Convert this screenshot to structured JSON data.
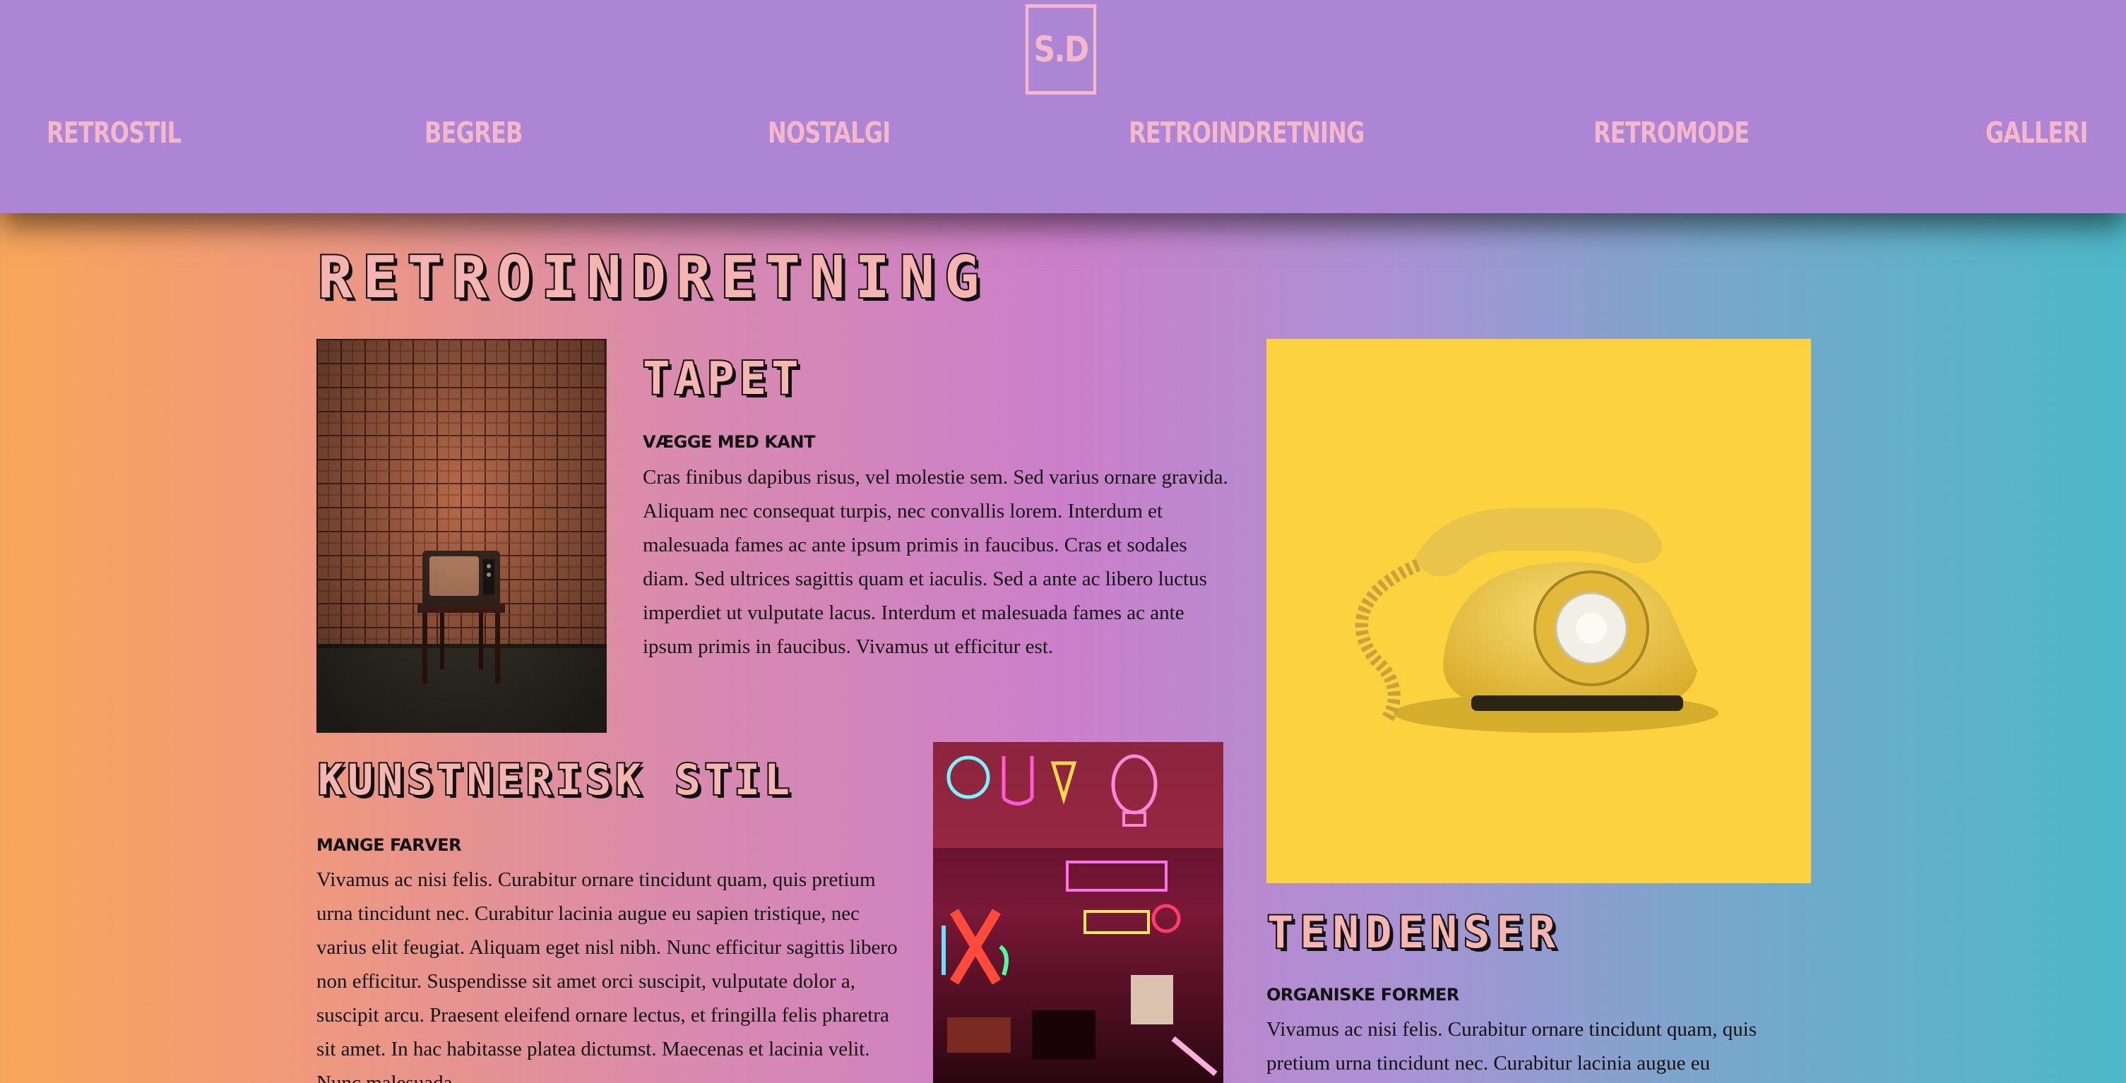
{
  "header": {
    "logo_text": "S.D",
    "nav": [
      {
        "label": "RETROSTIL"
      },
      {
        "label": "BEGREB"
      },
      {
        "label": "NOSTALGI"
      },
      {
        "label": "RETROINDRETNING"
      },
      {
        "label": "RETROMODE"
      },
      {
        "label": "GALLERI"
      }
    ]
  },
  "page": {
    "title": "RETROINDRETNING"
  },
  "sections": {
    "tapet": {
      "heading": "TAPET",
      "subheading": "VÆGGE MED KANT",
      "body": "Cras finibus dapibus risus, vel molestie sem. Sed varius ornare gravida. Aliquam nec consequat turpis, nec convallis lorem. Interdum et malesuada fames ac ante ipsum primis in faucibus. Cras et sodales diam. Sed ultrices sagittis quam et iaculis. Sed a ante ac libero luctus imperdiet ut vulputate lacus. Interdum et malesuada fames ac ante ipsum primis in faucibus. Vivamus ut efficitur est."
    },
    "kunstnerisk": {
      "heading": "KUNSTNERISK STIL",
      "subheading": "MANGE FARVER",
      "body": "Vivamus ac nisi felis. Curabitur ornare tincidunt quam, quis pretium urna tincidunt nec. Curabitur lacinia augue eu sapien tristique, nec varius elit feugiat. Aliquam eget nisl nibh. Nunc efficitur sagittis libero non efficitur. Suspendisse sit amet orci suscipit, vulputate dolor a, suscipit arcu. Praesent eleifend ornare lectus, et fringilla felis pharetra sit amet. In hac habitasse platea dictumst. Maecenas et lacinia velit. Nunc malesuada"
    },
    "tendenser": {
      "heading": "TENDENSER",
      "subheading": "ORGANISKE FORMER",
      "body": "Vivamus ac nisi felis. Curabitur ornare tincidunt quam, quis pretium urna tincidunt nec. Curabitur lacinia augue eu"
    }
  },
  "colors": {
    "header_bg": "#ad85d5",
    "nav_text": "#f5b8cb",
    "heading_fill": "#f6b5b0",
    "phone_bg": "#fdd23f"
  },
  "images": {
    "tv": "retro-tv-on-chair",
    "phone": "yellow-rotary-phone",
    "neon": "neon-signs-room"
  }
}
